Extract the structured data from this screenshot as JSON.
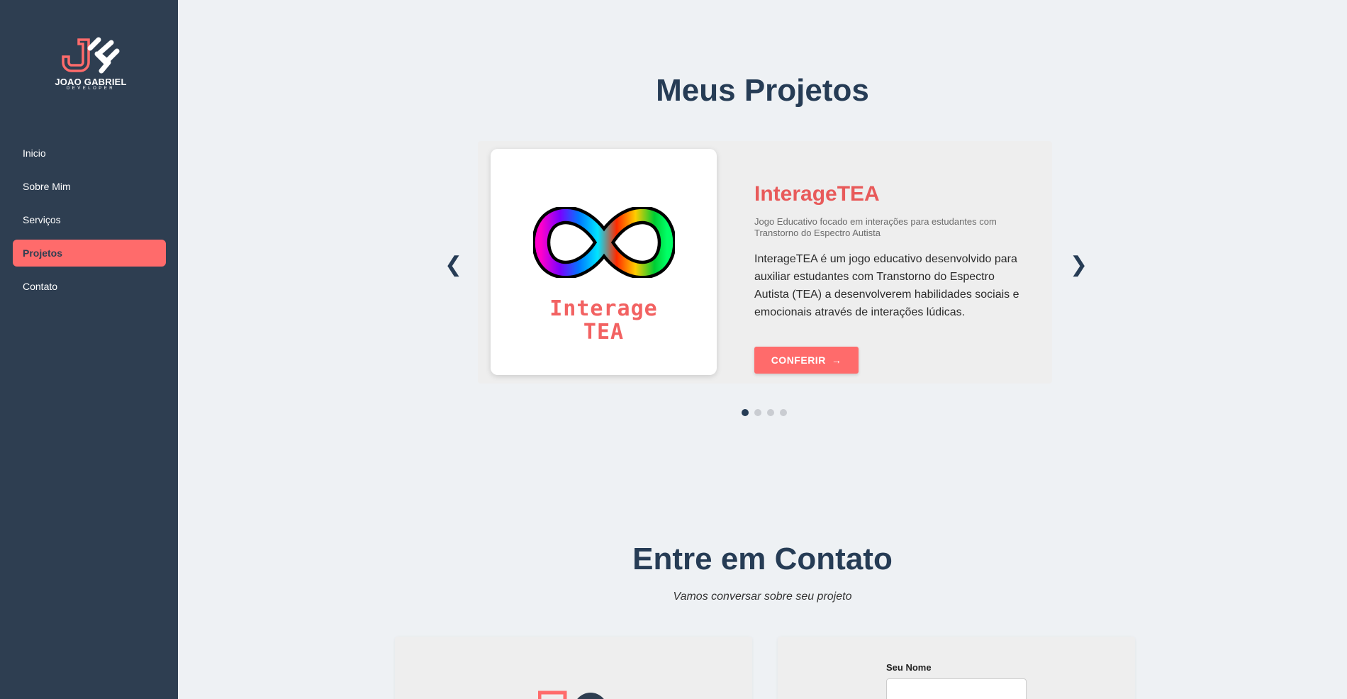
{
  "sidebar": {
    "logo_name": "JOAO GABRIEL",
    "logo_sub": "DEVELOPER",
    "items": [
      {
        "label": "Inicio"
      },
      {
        "label": "Sobre Mim"
      },
      {
        "label": "Serviços"
      },
      {
        "label": "Projetos",
        "active": true
      },
      {
        "label": "Contato"
      }
    ]
  },
  "projects": {
    "title": "Meus Projetos",
    "prev_icon": "❮",
    "next_icon": "❯",
    "card": {
      "image_text_line1": "Interage",
      "image_text_line2": "TEA",
      "name": "InterageTEA",
      "subtitle": "Jogo Educativo focado em interações para estudantes com Transtorno do Espectro Autista",
      "description": "InterageTEA é um jogo educativo desenvolvido para auxiliar estudantes com Transtorno do Espectro Autista (TEA) a desenvolverem habilidades sociais e emocionais através de interações lúdicas.",
      "button_label": "CONFERIR",
      "button_icon": "→"
    },
    "dots_count": 4,
    "active_dot": 0
  },
  "contact": {
    "title": "Entre em Contato",
    "subtitle": "Vamos conversar sobre seu projeto",
    "name_label": "Seu Nome",
    "name_value": ""
  },
  "colors": {
    "sidebar_bg": "#2e3e51",
    "accent": "#ff6b6b",
    "heading": "#263c55",
    "page_bg": "#eef1f4"
  },
  "icons": {
    "logo": "js-monogram-icon",
    "project_image": "rainbow-infinity-icon",
    "prev": "chevron-left-icon",
    "next": "chevron-right-icon",
    "button": "arrow-right-icon"
  }
}
